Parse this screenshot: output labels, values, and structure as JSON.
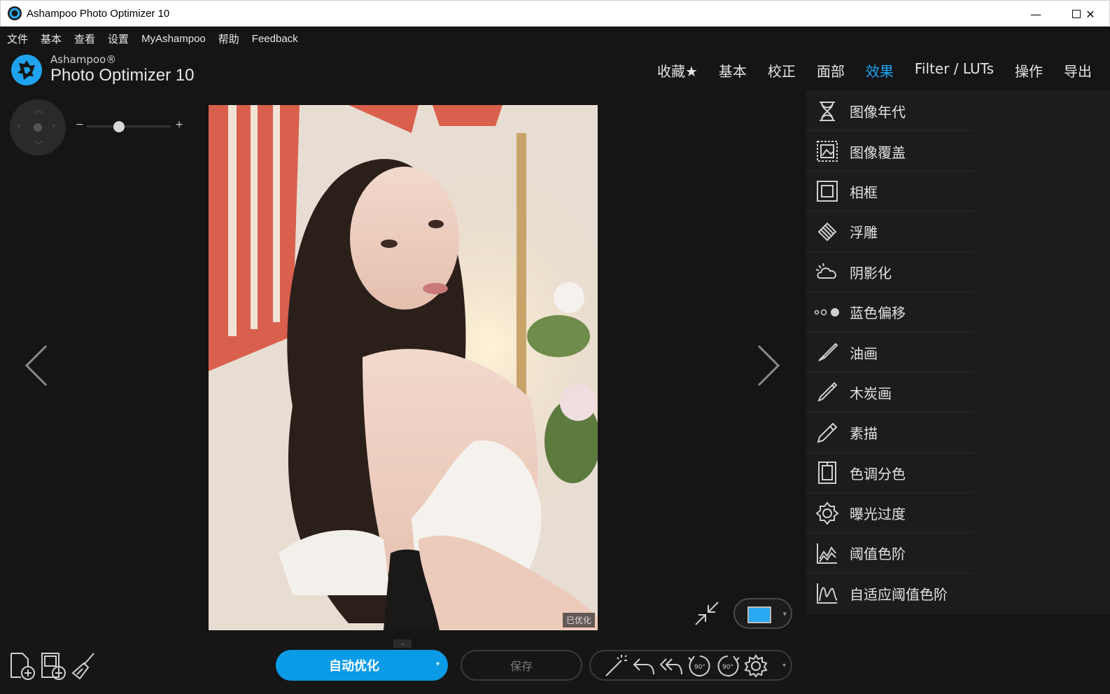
{
  "window": {
    "title": "Ashampoo Photo Optimizer 10",
    "controls": {
      "minimize": "—",
      "maximize": "☐",
      "close": "✕"
    }
  },
  "menu": [
    "文件",
    "基本",
    "查看",
    "设置",
    "MyAshampoo",
    "帮助",
    "Feedback"
  ],
  "brand": {
    "small": "Ashampoo®",
    "big": "Photo Optimizer 10"
  },
  "tabs": [
    {
      "label": "收藏★",
      "active": false
    },
    {
      "label": "基本",
      "active": false
    },
    {
      "label": "校正",
      "active": false
    },
    {
      "label": "面部",
      "active": false
    },
    {
      "label": "效果",
      "active": true
    },
    {
      "label": "Filter / LUTs",
      "active": false
    },
    {
      "label": "操作",
      "active": false
    },
    {
      "label": "导出",
      "active": false
    }
  ],
  "zoom": {
    "minus": "−",
    "plus": "+",
    "level": 0.38
  },
  "photo": {
    "badge": "已优化"
  },
  "effects": [
    {
      "label": "图像年代",
      "icon": "hourglass-icon"
    },
    {
      "label": "图像覆盖",
      "icon": "image-overlay-icon"
    },
    {
      "label": "相框",
      "icon": "frame-icon"
    },
    {
      "label": "浮雕",
      "icon": "emboss-icon"
    },
    {
      "label": "阴影化",
      "icon": "cloud-shadow-icon"
    },
    {
      "label": "蓝色偏移",
      "icon": "dots-shift-icon"
    },
    {
      "label": "油画",
      "icon": "brush-icon"
    },
    {
      "label": "木炭画",
      "icon": "charcoal-icon"
    },
    {
      "label": "素描",
      "icon": "pencil-icon"
    },
    {
      "label": "色调分色",
      "icon": "posterize-icon"
    },
    {
      "label": "曝光过度",
      "icon": "overexpose-icon"
    },
    {
      "label": "阈值色阶",
      "icon": "threshold-chart-icon"
    },
    {
      "label": "自适应阈值色阶",
      "icon": "adaptive-threshold-icon"
    }
  ],
  "bottom": {
    "auto_label": "自动优化",
    "save_label": "保存",
    "rotate_left": "90°",
    "rotate_right": "90°",
    "collapse": "⌄",
    "caret": "▾"
  },
  "colors": {
    "accent": "#1ba6f5",
    "button": "#0a9be8",
    "panel": "#1c1c1c",
    "background": "#151515"
  }
}
